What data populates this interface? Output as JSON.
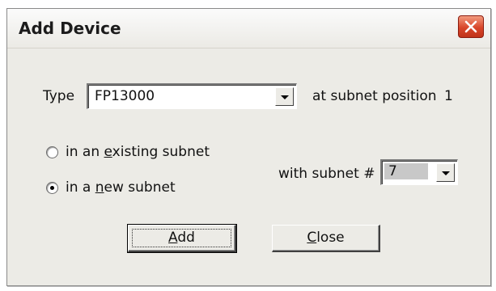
{
  "dialog": {
    "title": "Add Device",
    "type_label": "Type",
    "type_value": "FP13000",
    "position_label": "at subnet position",
    "position_value": "1",
    "radio_existing": {
      "prefix": "in an ",
      "accel": "e",
      "suffix": "xisting subnet",
      "checked": false
    },
    "radio_new": {
      "prefix": "in a ",
      "accel": "n",
      "suffix": "ew subnet",
      "checked": true
    },
    "subnet_label": "with subnet #",
    "subnet_value": "7",
    "add_button": {
      "accel": "A",
      "rest": "dd"
    },
    "close_button": {
      "accel": "C",
      "rest": "lose"
    },
    "colors": {
      "close_button": "#d8462a",
      "dialog_bg": "#ecebe6"
    }
  }
}
